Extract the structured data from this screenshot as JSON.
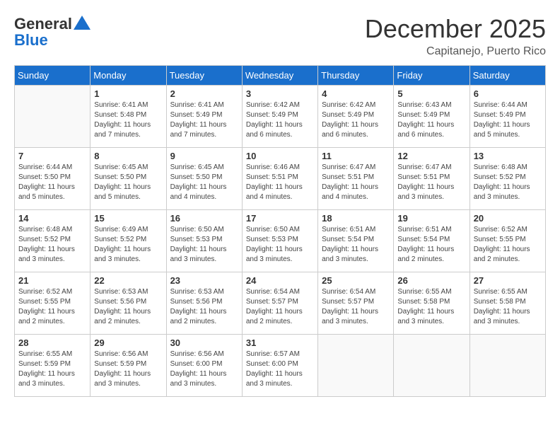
{
  "header": {
    "logo_line1": "General",
    "logo_line2": "Blue",
    "month": "December 2025",
    "location": "Capitanejo, Puerto Rico"
  },
  "weekdays": [
    "Sunday",
    "Monday",
    "Tuesday",
    "Wednesday",
    "Thursday",
    "Friday",
    "Saturday"
  ],
  "weeks": [
    [
      {
        "day": null
      },
      {
        "day": "1",
        "sunrise": "6:41 AM",
        "sunset": "5:48 PM",
        "daylight": "11 hours and 7 minutes."
      },
      {
        "day": "2",
        "sunrise": "6:41 AM",
        "sunset": "5:49 PM",
        "daylight": "11 hours and 7 minutes."
      },
      {
        "day": "3",
        "sunrise": "6:42 AM",
        "sunset": "5:49 PM",
        "daylight": "11 hours and 6 minutes."
      },
      {
        "day": "4",
        "sunrise": "6:42 AM",
        "sunset": "5:49 PM",
        "daylight": "11 hours and 6 minutes."
      },
      {
        "day": "5",
        "sunrise": "6:43 AM",
        "sunset": "5:49 PM",
        "daylight": "11 hours and 6 minutes."
      },
      {
        "day": "6",
        "sunrise": "6:44 AM",
        "sunset": "5:49 PM",
        "daylight": "11 hours and 5 minutes."
      }
    ],
    [
      {
        "day": "7",
        "sunrise": "6:44 AM",
        "sunset": "5:50 PM",
        "daylight": "11 hours and 5 minutes."
      },
      {
        "day": "8",
        "sunrise": "6:45 AM",
        "sunset": "5:50 PM",
        "daylight": "11 hours and 5 minutes."
      },
      {
        "day": "9",
        "sunrise": "6:45 AM",
        "sunset": "5:50 PM",
        "daylight": "11 hours and 4 minutes."
      },
      {
        "day": "10",
        "sunrise": "6:46 AM",
        "sunset": "5:51 PM",
        "daylight": "11 hours and 4 minutes."
      },
      {
        "day": "11",
        "sunrise": "6:47 AM",
        "sunset": "5:51 PM",
        "daylight": "11 hours and 4 minutes."
      },
      {
        "day": "12",
        "sunrise": "6:47 AM",
        "sunset": "5:51 PM",
        "daylight": "11 hours and 3 minutes."
      },
      {
        "day": "13",
        "sunrise": "6:48 AM",
        "sunset": "5:52 PM",
        "daylight": "11 hours and 3 minutes."
      }
    ],
    [
      {
        "day": "14",
        "sunrise": "6:48 AM",
        "sunset": "5:52 PM",
        "daylight": "11 hours and 3 minutes."
      },
      {
        "day": "15",
        "sunrise": "6:49 AM",
        "sunset": "5:52 PM",
        "daylight": "11 hours and 3 minutes."
      },
      {
        "day": "16",
        "sunrise": "6:50 AM",
        "sunset": "5:53 PM",
        "daylight": "11 hours and 3 minutes."
      },
      {
        "day": "17",
        "sunrise": "6:50 AM",
        "sunset": "5:53 PM",
        "daylight": "11 hours and 3 minutes."
      },
      {
        "day": "18",
        "sunrise": "6:51 AM",
        "sunset": "5:54 PM",
        "daylight": "11 hours and 3 minutes."
      },
      {
        "day": "19",
        "sunrise": "6:51 AM",
        "sunset": "5:54 PM",
        "daylight": "11 hours and 2 minutes."
      },
      {
        "day": "20",
        "sunrise": "6:52 AM",
        "sunset": "5:55 PM",
        "daylight": "11 hours and 2 minutes."
      }
    ],
    [
      {
        "day": "21",
        "sunrise": "6:52 AM",
        "sunset": "5:55 PM",
        "daylight": "11 hours and 2 minutes."
      },
      {
        "day": "22",
        "sunrise": "6:53 AM",
        "sunset": "5:56 PM",
        "daylight": "11 hours and 2 minutes."
      },
      {
        "day": "23",
        "sunrise": "6:53 AM",
        "sunset": "5:56 PM",
        "daylight": "11 hours and 2 minutes."
      },
      {
        "day": "24",
        "sunrise": "6:54 AM",
        "sunset": "5:57 PM",
        "daylight": "11 hours and 2 minutes."
      },
      {
        "day": "25",
        "sunrise": "6:54 AM",
        "sunset": "5:57 PM",
        "daylight": "11 hours and 3 minutes."
      },
      {
        "day": "26",
        "sunrise": "6:55 AM",
        "sunset": "5:58 PM",
        "daylight": "11 hours and 3 minutes."
      },
      {
        "day": "27",
        "sunrise": "6:55 AM",
        "sunset": "5:58 PM",
        "daylight": "11 hours and 3 minutes."
      }
    ],
    [
      {
        "day": "28",
        "sunrise": "6:55 AM",
        "sunset": "5:59 PM",
        "daylight": "11 hours and 3 minutes."
      },
      {
        "day": "29",
        "sunrise": "6:56 AM",
        "sunset": "5:59 PM",
        "daylight": "11 hours and 3 minutes."
      },
      {
        "day": "30",
        "sunrise": "6:56 AM",
        "sunset": "6:00 PM",
        "daylight": "11 hours and 3 minutes."
      },
      {
        "day": "31",
        "sunrise": "6:57 AM",
        "sunset": "6:00 PM",
        "daylight": "11 hours and 3 minutes."
      },
      {
        "day": null
      },
      {
        "day": null
      },
      {
        "day": null
      }
    ]
  ]
}
